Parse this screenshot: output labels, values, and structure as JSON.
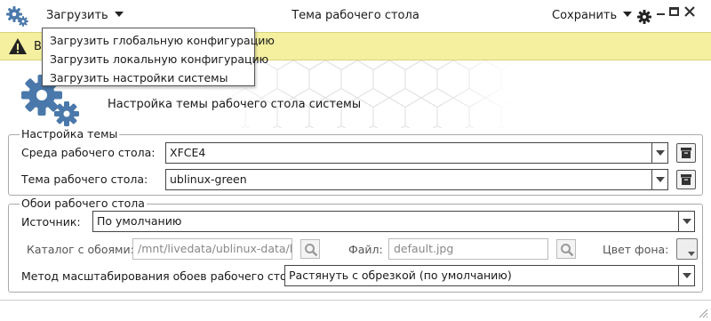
{
  "titlebar": {
    "load_label": "Загрузить",
    "title": "Тема рабочего стола",
    "save_label": "Сохранить"
  },
  "load_menu": {
    "items": [
      "Загрузить глобальную конфигурацию",
      "Загрузить локальную конфигурацию",
      "Загрузить настройки системы"
    ]
  },
  "warning": {
    "text": "В"
  },
  "banner": {
    "title": "Настройка темы рабочего стола системы"
  },
  "theme_group": {
    "legend": "Настройка темы",
    "desktop_env_label": "Среда рабочего стола:",
    "desktop_env_value": "XFCE4",
    "theme_label": "Тема рабочего стола:",
    "theme_value": "ublinux-green"
  },
  "wallpaper_group": {
    "legend": "Обои рабочего стола",
    "source_label": "Источник:",
    "source_value": "По умолчанию",
    "dir_label": "Каталог с обоями:",
    "dir_value": "/mnt/livedata/ublinux-data/ba",
    "file_label": "Файл:",
    "file_value": "default.jpg",
    "bg_color_label": "Цвет фона:",
    "scale_label": "Метод масштабирования обоев рабочего стола:",
    "scale_value": "Растянуть с обрезкой (по умолчанию)"
  },
  "colors": {
    "accent_icon": "#4a78aa",
    "warning_bg": "#f4f0a0"
  }
}
